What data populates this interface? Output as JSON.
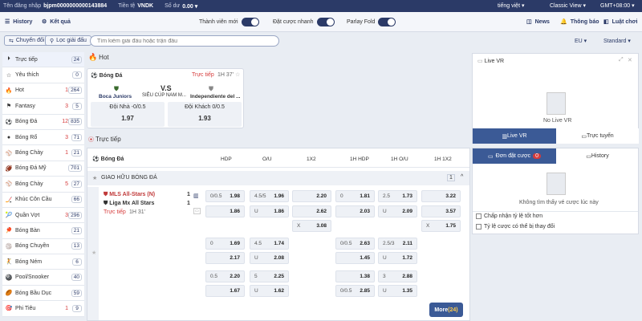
{
  "topbar": {
    "username_label": "Tên đăng nhập",
    "username": "bjpm0000000000143884",
    "currency_label": "Tiền tệ",
    "currency": "VNDK",
    "balance_label": "Số dư",
    "balance": "0.00",
    "language": "tiếng việt",
    "view": "Classic View",
    "timezone": "GMT+08:00"
  },
  "nav": {
    "history": "History",
    "results": "Kết quả",
    "member": "Thành viên mới",
    "quick_bet": "Đặt cược nhanh",
    "parlay": "Parlay Fold",
    "news": "News",
    "notify": "Thông báo",
    "rules": "Luật chơi"
  },
  "filter": {
    "switch": "Chuyển đổi",
    "league": "Lọc giải đấu",
    "search_placeholder": "Tìm kiếm giải đấu hoặc trận đấu",
    "region": "EU",
    "mode": "Standard"
  },
  "sidebar": [
    {
      "label": "Trực tiếp",
      "c1": "",
      "c2": "24"
    },
    {
      "label": "Yêu thích",
      "c1": "",
      "c2": "0"
    },
    {
      "label": "Hot",
      "c1": "1",
      "c2": "264"
    },
    {
      "label": "Fantasy",
      "c1": "3",
      "c2": "5"
    },
    {
      "label": "Bóng Đá",
      "c1": "12",
      "c2": "835"
    },
    {
      "label": "Bóng Rổ",
      "c1": "3",
      "c2": "71"
    },
    {
      "label": "Bóng Chày",
      "c1": "1",
      "c2": "21"
    },
    {
      "label": "Bóng Đá Mỹ",
      "c1": "",
      "c2": "701"
    },
    {
      "label": "Bóng Chày",
      "c1": "5",
      "c2": "27"
    },
    {
      "label": "Khúc Côn Cầu",
      "c1": "",
      "c2": "66"
    },
    {
      "label": "Quần Vợt",
      "c1": "3",
      "c2": "296"
    },
    {
      "label": "Bóng Bàn",
      "c1": "",
      "c2": "21"
    },
    {
      "label": "Bóng Chuyền",
      "c1": "",
      "c2": "13"
    },
    {
      "label": "Bóng Ném",
      "c1": "",
      "c2": "6"
    },
    {
      "label": "Pool/Snooker",
      "c1": "",
      "c2": "40"
    },
    {
      "label": "Bóng Bầu Dục",
      "c1": "",
      "c2": "59"
    },
    {
      "label": "Phi Tiêu",
      "c1": "1",
      "c2": "9"
    }
  ],
  "hot": {
    "title": "Hot",
    "sport": "Bóng Đá",
    "live": "Trực tiếp",
    "time": "1H 37'",
    "home": "Boca Juniors",
    "vs": "V.S",
    "league": "SIÊU CÚP NAM M...",
    "away": "Independiente del ...",
    "home_line": "Đội Nhà -0/0.5",
    "home_odds": "1.97",
    "away_line": "Đội Khách 0/0.5",
    "away_odds": "1.93"
  },
  "live": {
    "title": "Trực tiếp",
    "sport": "Bóng Đá",
    "cols": [
      "HDP",
      "O/U",
      "1X2",
      "1H HDP",
      "1H O/U",
      "1H 1X2"
    ],
    "league": "GIAO HỮU BÓNG ĐÁ",
    "league_count": "1",
    "home": "MLS All-Stars (N)",
    "away": "Liga Mx All Stars",
    "home_score": "1",
    "away_score": "1",
    "status": "Trực tiếp",
    "time": "1H 31'",
    "more": "More",
    "more_count": "(24)"
  },
  "right": {
    "livevr": "Live VR",
    "no_live": "No Live VR",
    "tab_livevr": "Live VR",
    "tab_online": "Trực tuyến",
    "tab_slip": "Đơn đặt cược",
    "slip_count": "0",
    "tab_history": "History",
    "empty": "Không tìm thấy vé cược lúc này",
    "opt1": "Chấp nhận tỷ lệ tốt hơn",
    "opt2": "Tỷ lệ cược có thể bị thay đổi"
  },
  "odds": [
    [
      "0/0.5",
      "1.98",
      "4.5/5",
      "1.96",
      "",
      "2.20",
      "0",
      "1.81",
      "2.5",
      "1.73",
      "",
      "3.22"
    ],
    [
      "",
      "1.86",
      "U",
      "1.86",
      "",
      "2.62",
      "",
      "2.03",
      "U",
      "2.09",
      "",
      "3.57"
    ],
    [
      "",
      "",
      "",
      "",
      "X",
      "3.08",
      "",
      "",
      "",
      "",
      "X",
      "1.75"
    ],
    [
      "0",
      "1.69",
      "4.5",
      "1.74",
      "",
      "",
      "0/0.5",
      "2.63",
      "2.5/3",
      "2.11",
      "",
      ""
    ],
    [
      "",
      "2.17",
      "U",
      "2.08",
      "",
      "",
      "",
      "1.45",
      "U",
      "1.72",
      "",
      ""
    ],
    [
      "0.5",
      "2.20",
      "5",
      "2.25",
      "",
      "",
      "",
      "1.38",
      "3",
      "2.88",
      "",
      ""
    ],
    [
      "",
      "1.67",
      "U",
      "1.62",
      "",
      "",
      "0/0.5",
      "2.85",
      "U",
      "1.35",
      "",
      ""
    ]
  ]
}
